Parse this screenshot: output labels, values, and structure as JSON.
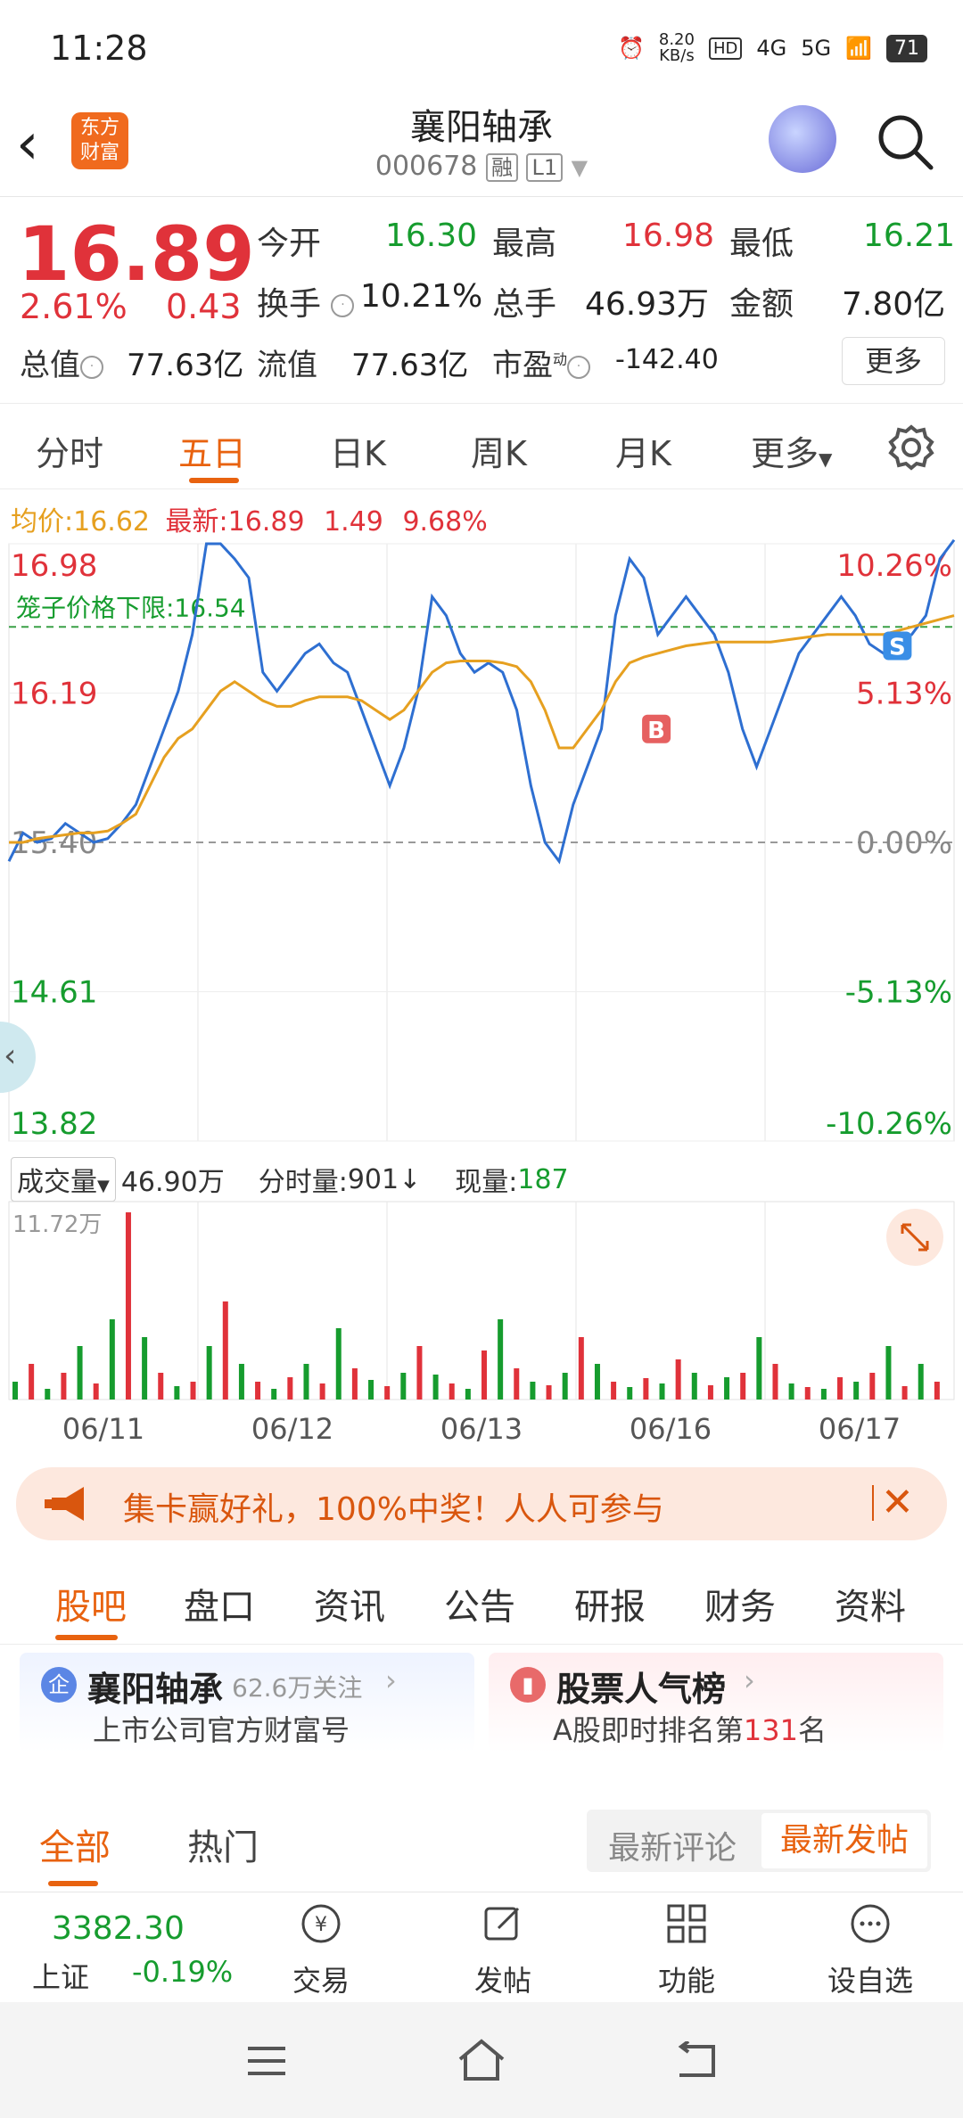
{
  "status": {
    "time": "11:28",
    "net_speed": "8.20",
    "net_unit": "KB/s",
    "battery": "71",
    "sig1": "4G",
    "sig2": "5G"
  },
  "header": {
    "title": "襄阳轴承",
    "code": "000678",
    "tag1": "融",
    "tag2": "L1",
    "logo_line1": "东方",
    "logo_line2": "财富"
  },
  "quote": {
    "price": "16.89",
    "chg_pct": "2.61%",
    "chg_val": "0.43",
    "open_label": "今开",
    "open": "16.30",
    "high_label": "最高",
    "high": "16.98",
    "low_label": "最低",
    "low": "16.21",
    "turnover_label": "换手",
    "turnover": "10.21%",
    "volume_label": "总手",
    "volume": "46.93万",
    "amount_label": "金额",
    "amount": "7.80亿",
    "mcap_label": "总值",
    "mcap": "77.63亿",
    "float_label": "流值",
    "float_mcap": "77.63亿",
    "pe_label": "市盈",
    "pe_sup": "动",
    "pe": "-142.40",
    "more": "更多"
  },
  "chart_tabs": [
    "分时",
    "五日",
    "日K",
    "周K",
    "月K",
    "更多"
  ],
  "legend": {
    "avg_label": "均价:",
    "avg": "16.62",
    "last_label": "最新:",
    "last": "16.89",
    "chg": "1.49",
    "pct": "9.68%"
  },
  "chart_data": {
    "type": "line",
    "y_labels_left": [
      "16.98",
      "16.19",
      "15.40",
      "14.61",
      "13.82"
    ],
    "y_labels_right": [
      "10.26%",
      "5.13%",
      "0.00%",
      "-5.13%",
      "-10.26%"
    ],
    "ylim": [
      13.82,
      16.98
    ],
    "limit_label": "笼子价格下限:",
    "limit_value": "16.54",
    "x_labels": [
      "06/11",
      "06/12",
      "06/13",
      "06/16",
      "06/17"
    ],
    "series": [
      {
        "name": "价格",
        "color": "#2e6fd1",
        "values": [
          15.3,
          15.45,
          15.4,
          15.42,
          15.5,
          15.45,
          15.4,
          15.42,
          15.5,
          15.6,
          15.8,
          16.0,
          16.2,
          16.5,
          16.98,
          16.98,
          16.9,
          16.8,
          16.3,
          16.2,
          16.3,
          16.4,
          16.45,
          16.35,
          16.3,
          16.1,
          15.9,
          15.7,
          15.9,
          16.2,
          16.7,
          16.6,
          16.4,
          16.3,
          16.35,
          16.3,
          16.1,
          15.7,
          15.4,
          15.3,
          15.6,
          15.8,
          16.0,
          16.6,
          16.9,
          16.8,
          16.5,
          16.6,
          16.7,
          16.6,
          16.5,
          16.3,
          16.0,
          15.8,
          16.0,
          16.2,
          16.4,
          16.5,
          16.6,
          16.7,
          16.6,
          16.45,
          16.4,
          16.45,
          16.5,
          16.6,
          16.9,
          17.0
        ]
      },
      {
        "name": "均价",
        "color": "#e6a020",
        "values": [
          15.4,
          15.4,
          15.42,
          15.43,
          15.44,
          15.45,
          15.45,
          15.46,
          15.5,
          15.55,
          15.7,
          15.85,
          15.95,
          16.0,
          16.1,
          16.2,
          16.25,
          16.2,
          16.15,
          16.12,
          16.12,
          16.15,
          16.17,
          16.17,
          16.17,
          16.15,
          16.1,
          16.05,
          16.1,
          16.2,
          16.3,
          16.35,
          16.36,
          16.36,
          16.36,
          16.35,
          16.33,
          16.25,
          16.1,
          15.9,
          15.9,
          16.0,
          16.1,
          16.25,
          16.35,
          16.38,
          16.4,
          16.42,
          16.44,
          16.45,
          16.46,
          16.46,
          16.46,
          16.46,
          16.46,
          16.47,
          16.48,
          16.49,
          16.5,
          16.5,
          16.5,
          16.5,
          16.5,
          16.52,
          16.54,
          16.56,
          16.58,
          16.6
        ]
      }
    ],
    "markers": [
      {
        "label": "B",
        "color": "#e66060"
      },
      {
        "label": "S",
        "color": "#3a8ee6"
      }
    ],
    "volume": {
      "label": "成交量",
      "total": "46.90万",
      "tick_label": "分时量:",
      "tick": "901",
      "tick_arrow": "↓",
      "current_label": "现量:",
      "current": "187",
      "max_label": "11.72万"
    }
  },
  "banner": {
    "text": "集卡赢好礼，100%中奖！人人可参与"
  },
  "section_tabs": [
    "股吧",
    "盘口",
    "资讯",
    "公告",
    "研报",
    "财务",
    "资料"
  ],
  "cards": {
    "company": {
      "icon": "企",
      "title": "襄阳轴承",
      "follow": "62.6万关注",
      "sub": "上市公司官方财富号"
    },
    "rank": {
      "title": "股票人气榜",
      "sub_pre": "A股即时排名第",
      "rank": "131",
      "sub_post": "名"
    }
  },
  "feed": {
    "all": "全部",
    "hot": "热门",
    "sort_comment": "最新评论",
    "sort_post": "最新发帖"
  },
  "bottom_bar": {
    "index_value": "3382.30",
    "index_name": "上证",
    "index_chg": "-0.19%",
    "trade": "交易",
    "post": "发帖",
    "func": "功能",
    "watch": "设自选"
  }
}
